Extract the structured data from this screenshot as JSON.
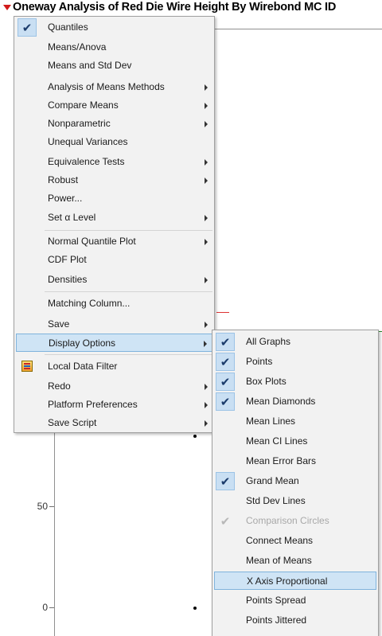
{
  "report": {
    "title": "Oneway Analysis of Red Die Wire Height By Wirebond MC ID",
    "y_ticks": [
      "50",
      "0"
    ]
  },
  "main_menu": {
    "items": [
      {
        "label": "Quantiles",
        "checked": true,
        "submenu": false
      },
      {
        "label": "Means/Anova",
        "checked": false,
        "submenu": false
      },
      {
        "label": "Means and Std Dev",
        "checked": false,
        "submenu": false
      },
      {
        "label": "Analysis of Means Methods",
        "checked": false,
        "submenu": true
      },
      {
        "label": "Compare Means",
        "checked": false,
        "submenu": true
      },
      {
        "label": "Nonparametric",
        "checked": false,
        "submenu": true
      },
      {
        "label": "Unequal Variances",
        "checked": false,
        "submenu": false
      },
      {
        "label": "Equivalence Tests",
        "checked": false,
        "submenu": true
      },
      {
        "label": "Robust",
        "checked": false,
        "submenu": true
      },
      {
        "label": "Power...",
        "checked": false,
        "submenu": false
      },
      {
        "label": "Set α Level",
        "checked": false,
        "submenu": true
      },
      {
        "label": "Normal Quantile Plot",
        "checked": false,
        "submenu": true
      },
      {
        "label": "CDF Plot",
        "checked": false,
        "submenu": false
      },
      {
        "label": "Densities",
        "checked": false,
        "submenu": true
      },
      {
        "label": "Matching Column...",
        "checked": false,
        "submenu": false
      },
      {
        "label": "Save",
        "checked": false,
        "submenu": true
      },
      {
        "label": "Display Options",
        "checked": false,
        "submenu": true,
        "active": true
      },
      {
        "label": "Local Data Filter",
        "checked": false,
        "submenu": false,
        "icon": "data-filter-icon"
      },
      {
        "label": "Redo",
        "checked": false,
        "submenu": true
      },
      {
        "label": "Platform Preferences",
        "checked": false,
        "submenu": true
      },
      {
        "label": "Save Script",
        "checked": false,
        "submenu": true
      }
    ]
  },
  "display_options_menu": {
    "items": [
      {
        "label": "All Graphs",
        "checked": true
      },
      {
        "label": "Points",
        "checked": true
      },
      {
        "label": "Box Plots",
        "checked": true
      },
      {
        "label": "Mean Diamonds",
        "checked": true
      },
      {
        "label": "Mean Lines",
        "checked": false
      },
      {
        "label": "Mean CI Lines",
        "checked": false
      },
      {
        "label": "Mean Error Bars",
        "checked": false
      },
      {
        "label": "Grand Mean",
        "checked": true
      },
      {
        "label": "Std Dev Lines",
        "checked": false
      },
      {
        "label": "Comparison Circles",
        "checked": true,
        "disabled": true
      },
      {
        "label": "Connect Means",
        "checked": false
      },
      {
        "label": "Mean of Means",
        "checked": false
      },
      {
        "label": "X Axis Proportional",
        "checked": false,
        "highlighted": true
      },
      {
        "label": "Points Spread",
        "checked": false
      },
      {
        "label": "Points Jittered",
        "checked": false
      }
    ]
  },
  "colors": {
    "accent_red": "#d21a1a",
    "highlight": "#cfe4f5",
    "check_bg": "#c9dff3"
  }
}
